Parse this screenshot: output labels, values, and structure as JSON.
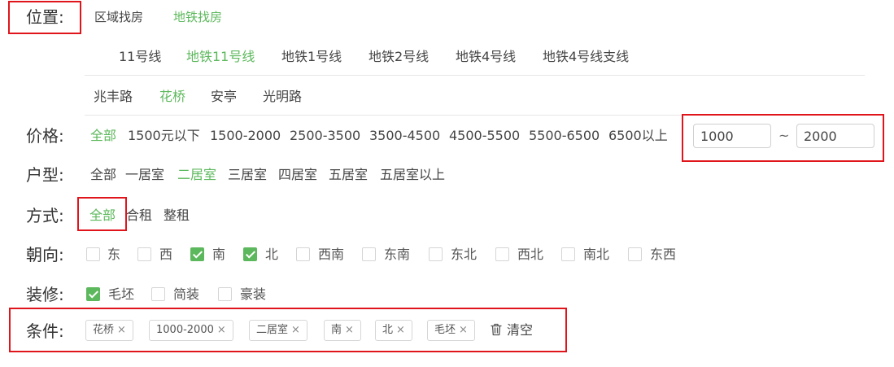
{
  "location": {
    "label": "位置:",
    "modes": [
      "区域找房",
      "地铁找房"
    ],
    "lines": [
      "11号线",
      "地铁11号线",
      "地铁1号线",
      "地铁2号线",
      "地铁4号线",
      "地铁4号线支线"
    ],
    "stations": [
      "兆丰路",
      "花桥",
      "安亭",
      "光明路"
    ]
  },
  "price": {
    "label": "价格:",
    "options": [
      "全部",
      "1500元以下",
      "1500-2000",
      "2500-3500",
      "3500-4500",
      "4500-5500",
      "5500-6500",
      "6500以上"
    ],
    "min": "1000",
    "separator": "~",
    "max": "2000"
  },
  "layout_type": {
    "label": "户型:",
    "options": [
      "全部",
      "一居室",
      "二居室",
      "三居室",
      "四居室",
      "五居室",
      "五居室以上"
    ]
  },
  "rent_mode": {
    "label": "方式:",
    "options": [
      "全部",
      "合租",
      "整租"
    ]
  },
  "orientation": {
    "label": "朝向:",
    "options": [
      {
        "text": "东",
        "checked": false
      },
      {
        "text": "西",
        "checked": false
      },
      {
        "text": "南",
        "checked": true
      },
      {
        "text": "北",
        "checked": true
      },
      {
        "text": "西南",
        "checked": false
      },
      {
        "text": "东南",
        "checked": false
      },
      {
        "text": "东北",
        "checked": false
      },
      {
        "text": "西北",
        "checked": false
      },
      {
        "text": "南北",
        "checked": false
      },
      {
        "text": "东西",
        "checked": false
      }
    ]
  },
  "decoration": {
    "label": "装修:",
    "options": [
      {
        "text": "毛坯",
        "checked": true
      },
      {
        "text": "简装",
        "checked": false
      },
      {
        "text": "豪装",
        "checked": false
      }
    ]
  },
  "conditions": {
    "label": "条件:",
    "tags": [
      "花桥",
      "1000-2000",
      "二居室",
      "南",
      "北",
      "毛坯"
    ],
    "remove_symbol": "×",
    "clear_label": "清空"
  },
  "colors": {
    "accent": "#5cb85c",
    "highlight_border": "#e0151c"
  }
}
